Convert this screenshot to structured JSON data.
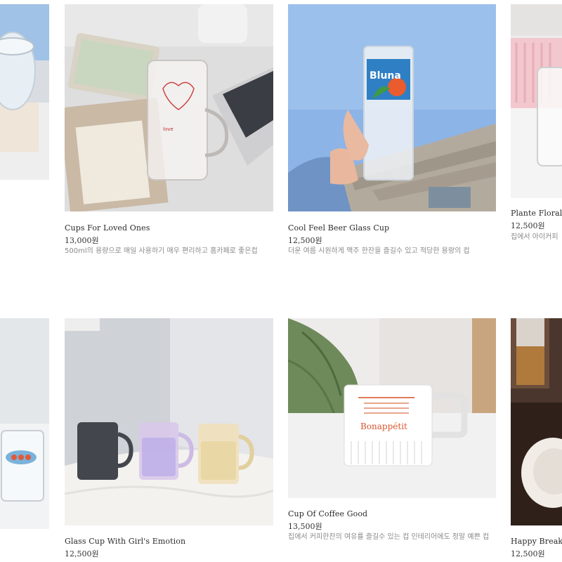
{
  "products": [
    {
      "title": "Cups For Loved Ones",
      "price": "13,000원",
      "description": "500ml의 용량으로 매일 사용하기 매우 편리하고 홈카페로 좋은컵"
    },
    {
      "title": "Cool Feel Beer Glass Cup",
      "price": "12,500원",
      "description": "더운 여름 시원하게 맥주 한잔을 즐길수 있고 적당한 용량의 컵",
      "can_label": "Bluna"
    },
    {
      "title": "Plante Florale",
      "price": "12,500원",
      "description": "집에서 아이커피"
    },
    {
      "title": "Glass Cup With Girl's Emotion",
      "price": "12,500원",
      "description": ""
    },
    {
      "title": "Cup Of Coffee Good",
      "price": "13,500원",
      "description": "집에서 커피한잔의 여유를 즐길수 있는 컵 인테리어에도 정말 예쁜 컵",
      "mug_text": "Bonappétit"
    },
    {
      "title": "Happy Breakfa",
      "price": "12,500원",
      "description": ""
    }
  ]
}
